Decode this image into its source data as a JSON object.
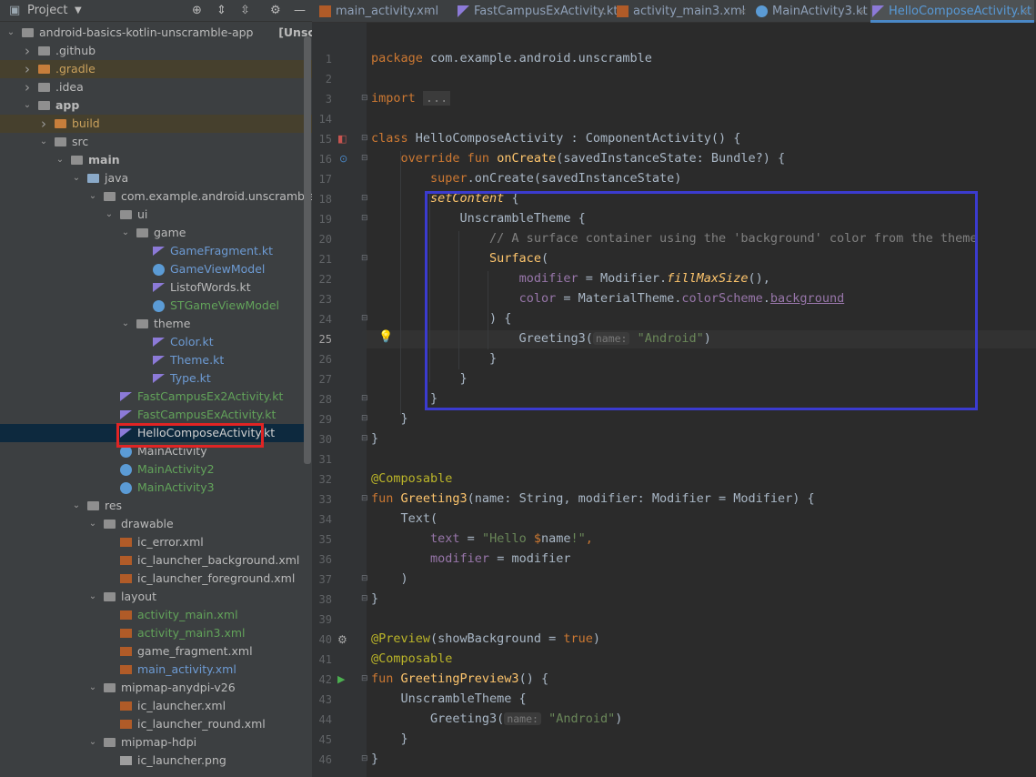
{
  "project_panel": {
    "title": "Project",
    "tree": [
      {
        "label": "android-basics-kotlin-unscramble-app",
        "suffix": "[Unscramble]",
        "depth": 0,
        "open": true,
        "icon": "folder"
      },
      {
        "label": ".github",
        "depth": 1,
        "open": false,
        "icon": "folder"
      },
      {
        "label": ".gradle",
        "depth": 1,
        "open": false,
        "icon": "folder-orange",
        "highlight": true
      },
      {
        "label": ".idea",
        "depth": 1,
        "open": false,
        "icon": "folder",
        "highlight": false
      },
      {
        "label": "app",
        "depth": 1,
        "open": true,
        "icon": "module-folder",
        "bold": true
      },
      {
        "label": "build",
        "depth": 2,
        "open": false,
        "icon": "folder-orange",
        "highlight": true
      },
      {
        "label": "src",
        "depth": 2,
        "open": true,
        "icon": "folder"
      },
      {
        "label": "main",
        "depth": 3,
        "open": true,
        "icon": "folder",
        "bold": true
      },
      {
        "label": "java",
        "depth": 4,
        "open": true,
        "icon": "folder-blue"
      },
      {
        "label": "com.example.android.unscramble",
        "depth": 5,
        "open": true,
        "icon": "package"
      },
      {
        "label": "ui",
        "depth": 6,
        "open": true,
        "icon": "package"
      },
      {
        "label": "game",
        "depth": 7,
        "open": true,
        "icon": "package"
      },
      {
        "label": "GameFragment.kt",
        "depth": 8,
        "icon": "kotlin-file",
        "color": "blue"
      },
      {
        "label": "GameViewModel",
        "depth": 8,
        "icon": "kotlin-class",
        "color": "blue"
      },
      {
        "label": "ListofWords.kt",
        "depth": 8,
        "icon": "kotlin-file",
        "color": "plain"
      },
      {
        "label": "STGameViewModel",
        "depth": 8,
        "icon": "kotlin-class",
        "color": "green"
      },
      {
        "label": "theme",
        "depth": 7,
        "open": true,
        "icon": "package"
      },
      {
        "label": "Color.kt",
        "depth": 8,
        "icon": "kotlin-file",
        "color": "blue"
      },
      {
        "label": "Theme.kt",
        "depth": 8,
        "icon": "kotlin-file",
        "color": "blue"
      },
      {
        "label": "Type.kt",
        "depth": 8,
        "icon": "kotlin-file",
        "color": "blue"
      },
      {
        "label": "FastCampusEx2Activity.kt",
        "depth": 6,
        "icon": "kotlin-file",
        "color": "green"
      },
      {
        "label": "FastCampusExActivity.kt",
        "depth": 6,
        "icon": "kotlin-file",
        "color": "green"
      },
      {
        "label": "HelloComposeActivity.kt",
        "depth": 6,
        "icon": "kotlin-file",
        "color": "green",
        "selected": true
      },
      {
        "label": "MainActivity",
        "depth": 6,
        "icon": "kotlin-class",
        "color": "plain"
      },
      {
        "label": "MainActivity2",
        "depth": 6,
        "icon": "kotlin-class",
        "color": "green"
      },
      {
        "label": "MainActivity3",
        "depth": 6,
        "icon": "kotlin-class",
        "color": "green"
      },
      {
        "label": "res",
        "depth": 4,
        "open": true,
        "icon": "res-folder"
      },
      {
        "label": "drawable",
        "depth": 5,
        "open": true,
        "icon": "folder"
      },
      {
        "label": "ic_error.xml",
        "depth": 6,
        "icon": "xml-file",
        "color": "plain"
      },
      {
        "label": "ic_launcher_background.xml",
        "depth": 6,
        "icon": "xml-file",
        "color": "plain"
      },
      {
        "label": "ic_launcher_foreground.xml",
        "depth": 6,
        "icon": "xml-file",
        "color": "plain"
      },
      {
        "label": "layout",
        "depth": 5,
        "open": true,
        "icon": "folder"
      },
      {
        "label": "activity_main.xml",
        "depth": 6,
        "icon": "xml-file",
        "color": "green"
      },
      {
        "label": "activity_main3.xml",
        "depth": 6,
        "icon": "xml-file",
        "color": "green"
      },
      {
        "label": "game_fragment.xml",
        "depth": 6,
        "icon": "xml-file",
        "color": "plain"
      },
      {
        "label": "main_activity.xml",
        "depth": 6,
        "icon": "xml-file",
        "color": "blue"
      },
      {
        "label": "mipmap-anydpi-v26",
        "depth": 5,
        "open": true,
        "icon": "folder"
      },
      {
        "label": "ic_launcher.xml",
        "depth": 6,
        "icon": "xml-file",
        "color": "plain"
      },
      {
        "label": "ic_launcher_round.xml",
        "depth": 6,
        "icon": "xml-file",
        "color": "plain"
      },
      {
        "label": "mipmap-hdpi",
        "depth": 5,
        "open": true,
        "icon": "folder"
      },
      {
        "label": "ic_launcher.png",
        "depth": 6,
        "icon": "png-file",
        "color": "plain"
      }
    ]
  },
  "tabs": [
    {
      "label": "main_activity.xml",
      "icon": "xml-file",
      "close": "×"
    },
    {
      "label": "FastCampusExActivity.kt",
      "icon": "kotlin-file",
      "close": "×"
    },
    {
      "label": "activity_main3.xml",
      "icon": "xml-file",
      "close": "×"
    },
    {
      "label": "MainActivity3.kt",
      "icon": "kotlin-class",
      "close": "×"
    },
    {
      "label": "HelloComposeActivity.kt",
      "icon": "kotlin-file",
      "close": "×",
      "active": true
    }
  ],
  "editor": {
    "current_line": 25,
    "line_numbers": [
      "1",
      "2",
      "3",
      "14",
      "15",
      "16",
      "17",
      "18",
      "19",
      "20",
      "21",
      "22",
      "23",
      "24",
      "25",
      "26",
      "27",
      "28",
      "29",
      "30",
      "31",
      "32",
      "33",
      "34",
      "35",
      "36",
      "37",
      "38",
      "39",
      "40",
      "41",
      "42",
      "43",
      "44",
      "45",
      "46"
    ]
  },
  "code_lines": [
    [
      [
        "kw",
        "package "
      ],
      [
        "",
        "com.example.android.unscramble"
      ]
    ],
    [],
    [
      [
        "kw",
        "import "
      ],
      [
        "fold-dots",
        "..."
      ]
    ],
    [],
    [
      [
        "kw",
        "class "
      ],
      [
        "",
        "HelloComposeActivity : ComponentActivity() {"
      ]
    ],
    [
      [
        "",
        "    "
      ],
      [
        "kw",
        "override fun "
      ],
      [
        "fn",
        "onCreate"
      ],
      [
        "",
        "(savedInstanceState: Bundle?) {"
      ]
    ],
    [
      [
        "",
        "        "
      ],
      [
        "kw",
        "super"
      ],
      [
        "",
        ".onCreate(savedInstanceState)"
      ]
    ],
    [
      [
        "",
        "        "
      ],
      [
        "fn it",
        "setContent"
      ],
      [
        "",
        " {"
      ]
    ],
    [
      [
        "",
        "            UnscrambleTheme {"
      ]
    ],
    [
      [
        "",
        "                "
      ],
      [
        "cm",
        "// A surface container using the 'background' color from the theme"
      ]
    ],
    [
      [
        "",
        "                "
      ],
      [
        "fn",
        "Surface"
      ],
      [
        "",
        "("
      ]
    ],
    [
      [
        "",
        "                    "
      ],
      [
        "prop",
        "modifier"
      ],
      [
        "",
        " = Modifier."
      ],
      [
        "fn it",
        "fillMaxSize"
      ],
      [
        "",
        "(),"
      ]
    ],
    [
      [
        "",
        "                    "
      ],
      [
        "prop",
        "color"
      ],
      [
        "",
        " = MaterialTheme."
      ],
      [
        "prop",
        "colorScheme"
      ],
      [
        "",
        "."
      ],
      [
        "prop ul",
        "background"
      ]
    ],
    [
      [
        "",
        "                ) {"
      ]
    ],
    [
      [
        "",
        "                    Greeting3("
      ],
      [
        "hint",
        "name:"
      ],
      [
        "",
        " "
      ],
      [
        "str",
        "\"Android\""
      ],
      [
        "",
        ")"
      ]
    ],
    [
      [
        "",
        "                }"
      ]
    ],
    [
      [
        "",
        "            }"
      ]
    ],
    [
      [
        "",
        "        }"
      ]
    ],
    [
      [
        "",
        "    }"
      ]
    ],
    [
      [
        "",
        "}"
      ]
    ],
    [],
    [
      [
        "ann",
        "@Composable"
      ]
    ],
    [
      [
        "kw",
        "fun "
      ],
      [
        "fn",
        "Greeting3"
      ],
      [
        "",
        "(name: String, modifier: Modifier = Modifier) {"
      ]
    ],
    [
      [
        "",
        "    Text("
      ]
    ],
    [
      [
        "",
        "        "
      ],
      [
        "prop",
        "text"
      ],
      [
        "",
        " = "
      ],
      [
        "str",
        "\"Hello "
      ],
      [
        "kw",
        "$"
      ],
      [
        "",
        "name"
      ],
      [
        "str",
        "!\""
      ],
      [
        "kw",
        ","
      ]
    ],
    [
      [
        "",
        "        "
      ],
      [
        "prop",
        "modifier"
      ],
      [
        "",
        " = modifier"
      ]
    ],
    [
      [
        "",
        "    )"
      ]
    ],
    [
      [
        "",
        "}"
      ]
    ],
    [],
    [
      [
        "ann",
        "@Preview"
      ],
      [
        "",
        "(showBackground = "
      ],
      [
        "kw",
        "true"
      ],
      [
        "",
        ")"
      ]
    ],
    [
      [
        "ann",
        "@Composable"
      ]
    ],
    [
      [
        "kw",
        "fun "
      ],
      [
        "fn",
        "GreetingPreview3"
      ],
      [
        "",
        "() {"
      ]
    ],
    [
      [
        "",
        "    UnscrambleTheme {"
      ]
    ],
    [
      [
        "",
        "        Greeting3("
      ],
      [
        "hint",
        "name:"
      ],
      [
        "",
        " "
      ],
      [
        "str",
        "\"Android\""
      ],
      [
        "",
        ")"
      ]
    ],
    [
      [
        "",
        "    }"
      ]
    ],
    [
      [
        "",
        "}"
      ]
    ]
  ]
}
